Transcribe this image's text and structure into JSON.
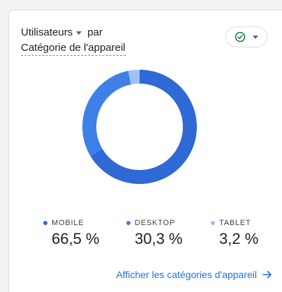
{
  "card": {
    "metric_label": "Utilisateurs",
    "by_label": "par",
    "dimension_label": "Catégorie de l'appareil",
    "status_icon": "check-circle-icon",
    "footer_link_label": "Afficher les catégories d'appareil",
    "footer_link_icon": "arrow-right-icon"
  },
  "colors": {
    "mobile": "#2f69d6",
    "desktop": "#3f7fe8",
    "tablet": "#9fc1f5",
    "accent": "#1a73e8",
    "check": "#188038"
  },
  "legend": [
    {
      "label": "MOBILE",
      "value": "66,5 %"
    },
    {
      "label": "DESKTOP",
      "value": "30,3 %"
    },
    {
      "label": "TABLET",
      "value": "3,2 %"
    }
  ],
  "chart_data": {
    "type": "pie",
    "categories": [
      "MOBILE",
      "DESKTOP",
      "TABLET"
    ],
    "values": [
      66.5,
      30.3,
      3.2
    ]
  }
}
